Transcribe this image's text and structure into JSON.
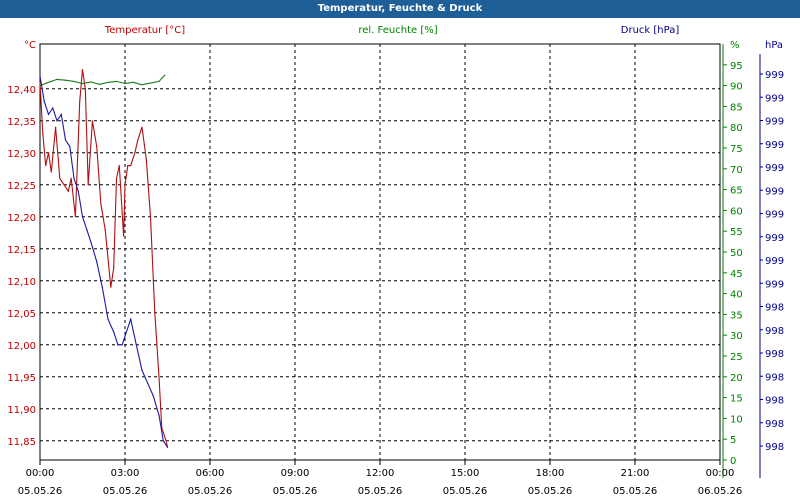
{
  "window": {
    "title": "Temperatur, Feuchte & Druck"
  },
  "chart_data": {
    "type": "line",
    "title": "Temperatur, Feuchte & Druck",
    "grid": true,
    "x_range": [
      0,
      24
    ],
    "x_ticks": [
      {
        "time": "00:00",
        "date": "05.05.26"
      },
      {
        "time": "03:00",
        "date": "05.05.26"
      },
      {
        "time": "06:00",
        "date": "05.05.26"
      },
      {
        "time": "09:00",
        "date": "05.05.26"
      },
      {
        "time": "12:00",
        "date": "05.05.26"
      },
      {
        "time": "15:00",
        "date": "05.05.26"
      },
      {
        "time": "18:00",
        "date": "05.05.26"
      },
      {
        "time": "21:00",
        "date": "05.05.26"
      },
      {
        "time": "00:00",
        "date": "06.05.26"
      }
    ],
    "axes": {
      "left": {
        "unit": "°C",
        "label": "Temperatur [°C]",
        "color": "#c00000",
        "range": [
          11.82,
          12.47
        ],
        "ticks": [
          "12,40",
          "12,35",
          "12,30",
          "12,25",
          "12,20",
          "12,15",
          "12,10",
          "12,05",
          "12,00",
          "11,95",
          "11,90",
          "11,85"
        ]
      },
      "right_humidity": {
        "unit": "%",
        "label": "rel. Feuchte [%]",
        "color": "#008000",
        "range": [
          0,
          100
        ],
        "ticks": [
          "95",
          "90",
          "85",
          "80",
          "75",
          "70",
          "65",
          "60",
          "55",
          "50",
          "45",
          "40",
          "35",
          "30",
          "25",
          "20",
          "15",
          "10",
          "5",
          "0"
        ]
      },
      "right_pressure": {
        "unit": "hPa",
        "label": "Druck [hPa]",
        "color": "#00008b",
        "ticks": [
          "999",
          "999",
          "999",
          "999",
          "999",
          "999",
          "999",
          "999",
          "999",
          "999",
          "998",
          "998",
          "998",
          "998",
          "998",
          "998",
          "998"
        ]
      }
    },
    "series": [
      {
        "name": "Temperatur [°C]",
        "axis": "left",
        "color": "#b01010",
        "x": [
          0.0,
          0.1,
          0.2,
          0.3,
          0.4,
          0.55,
          0.7,
          0.85,
          1.0,
          1.1,
          1.25,
          1.4,
          1.5,
          1.6,
          1.7,
          1.85,
          2.0,
          2.15,
          2.3,
          2.5,
          2.6,
          2.7,
          2.8,
          2.95,
          3.0,
          3.1,
          3.2,
          3.35,
          3.45,
          3.6,
          3.75,
          3.9,
          4.05,
          4.2,
          4.3,
          4.45,
          4.5
        ],
        "values": [
          12.41,
          12.33,
          12.28,
          12.3,
          12.27,
          12.34,
          12.26,
          12.25,
          12.24,
          12.26,
          12.2,
          12.38,
          12.43,
          12.4,
          12.25,
          12.35,
          12.31,
          12.22,
          12.18,
          12.09,
          12.12,
          12.26,
          12.28,
          12.17,
          12.25,
          12.28,
          12.28,
          12.3,
          12.32,
          12.34,
          12.29,
          12.2,
          12.05,
          11.95,
          11.87,
          11.85,
          11.84
        ]
      },
      {
        "name": "rel. Feuchte [%]",
        "axis": "right_humidity",
        "color": "#1a7a1a",
        "x": [
          0.0,
          0.3,
          0.6,
          0.9,
          1.2,
          1.5,
          1.8,
          2.1,
          2.4,
          2.7,
          3.0,
          3.3,
          3.6,
          3.9,
          4.2,
          4.4
        ],
        "values": [
          90.0,
          90.8,
          91.5,
          91.3,
          91.0,
          90.5,
          90.9,
          90.3,
          90.8,
          91.0,
          90.5,
          90.8,
          90.2,
          90.6,
          91.0,
          92.5
        ]
      },
      {
        "name": "Druck [hPa]",
        "axis": "right_pressure",
        "color": "#1a1aa0",
        "x": [
          0.0,
          0.15,
          0.3,
          0.45,
          0.6,
          0.75,
          0.9,
          1.05,
          1.2,
          1.35,
          1.5,
          1.65,
          1.8,
          2.0,
          2.2,
          2.4,
          2.6,
          2.75,
          2.9,
          3.05,
          3.2,
          3.4,
          3.6,
          3.8,
          4.0,
          4.2,
          4.35,
          4.5
        ],
        "values": [
          12.42,
          12.38,
          12.36,
          12.37,
          12.35,
          12.36,
          12.32,
          12.31,
          12.26,
          12.24,
          12.2,
          12.18,
          12.16,
          12.13,
          12.09,
          12.04,
          12.02,
          12.0,
          12.0,
          12.02,
          12.04,
          12.0,
          11.96,
          11.94,
          11.92,
          11.89,
          11.85,
          11.84
        ]
      }
    ]
  }
}
